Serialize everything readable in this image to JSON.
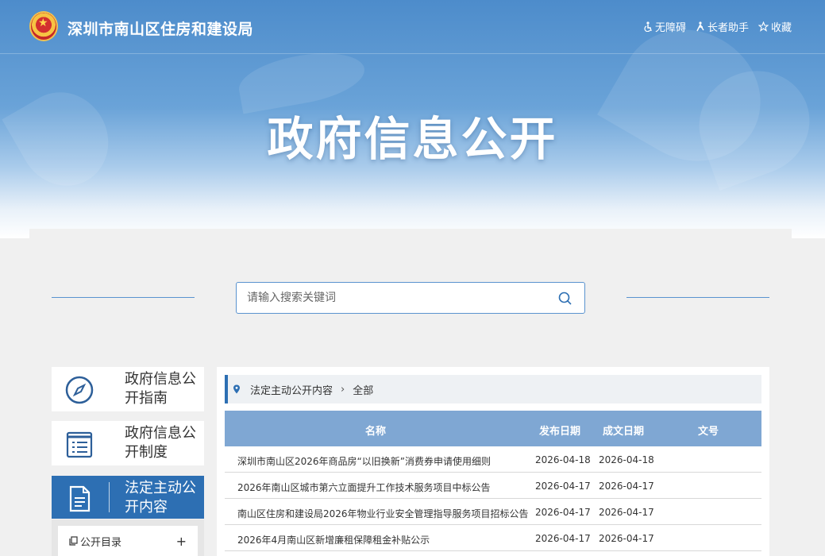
{
  "header": {
    "bureau_name": "深圳市南山区住房和建设局",
    "links": [
      {
        "icon": "accessibility-icon",
        "label": "无障碍"
      },
      {
        "icon": "elderly-assist-icon",
        "label": "长者助手"
      },
      {
        "icon": "star-icon",
        "label": "收藏"
      }
    ]
  },
  "banner": {
    "title": "政府信息公开"
  },
  "search": {
    "placeholder": "请输入搜索关键词",
    "value": ""
  },
  "leftnav": {
    "items": [
      {
        "icon": "compass-icon",
        "label": "政府信息公开指南",
        "active": false
      },
      {
        "icon": "document-list-icon",
        "label": "政府信息公开制度",
        "active": false
      },
      {
        "icon": "document-icon",
        "label": "法定主动公开内容",
        "active": true
      }
    ],
    "sub_items": [
      {
        "icon": "copy-icon",
        "label": "公开目录",
        "expand": "+"
      }
    ]
  },
  "breadcrumb": {
    "items": [
      "法定主动公开内容",
      "全部"
    ]
  },
  "table": {
    "columns": [
      "名称",
      "发布日期",
      "成文日期",
      "文号"
    ],
    "rows": [
      {
        "name": "深圳市南山区2026年商品房“以旧换新”消费券申请使用细则",
        "published": "2026-04-18",
        "written": "2026-04-18",
        "doc_no": ""
      },
      {
        "name": "2026年南山区城市第六立面提升工作技术服务项目中标公告",
        "published": "2026-04-17",
        "written": "2026-04-17",
        "doc_no": ""
      },
      {
        "name": "南山区住房和建设局2026年物业行业安全管理指导服务项目招标公告",
        "published": "2026-04-17",
        "written": "2026-04-17",
        "doc_no": ""
      },
      {
        "name": "2026年4月南山区新增廉租保障租金补贴公示",
        "published": "2026-04-17",
        "written": "2026-04-17",
        "doc_no": ""
      }
    ]
  },
  "colors": {
    "primary": "#2d6fb3",
    "table_header": "#7fa7d3",
    "banner_top": "#4d8ccb"
  }
}
